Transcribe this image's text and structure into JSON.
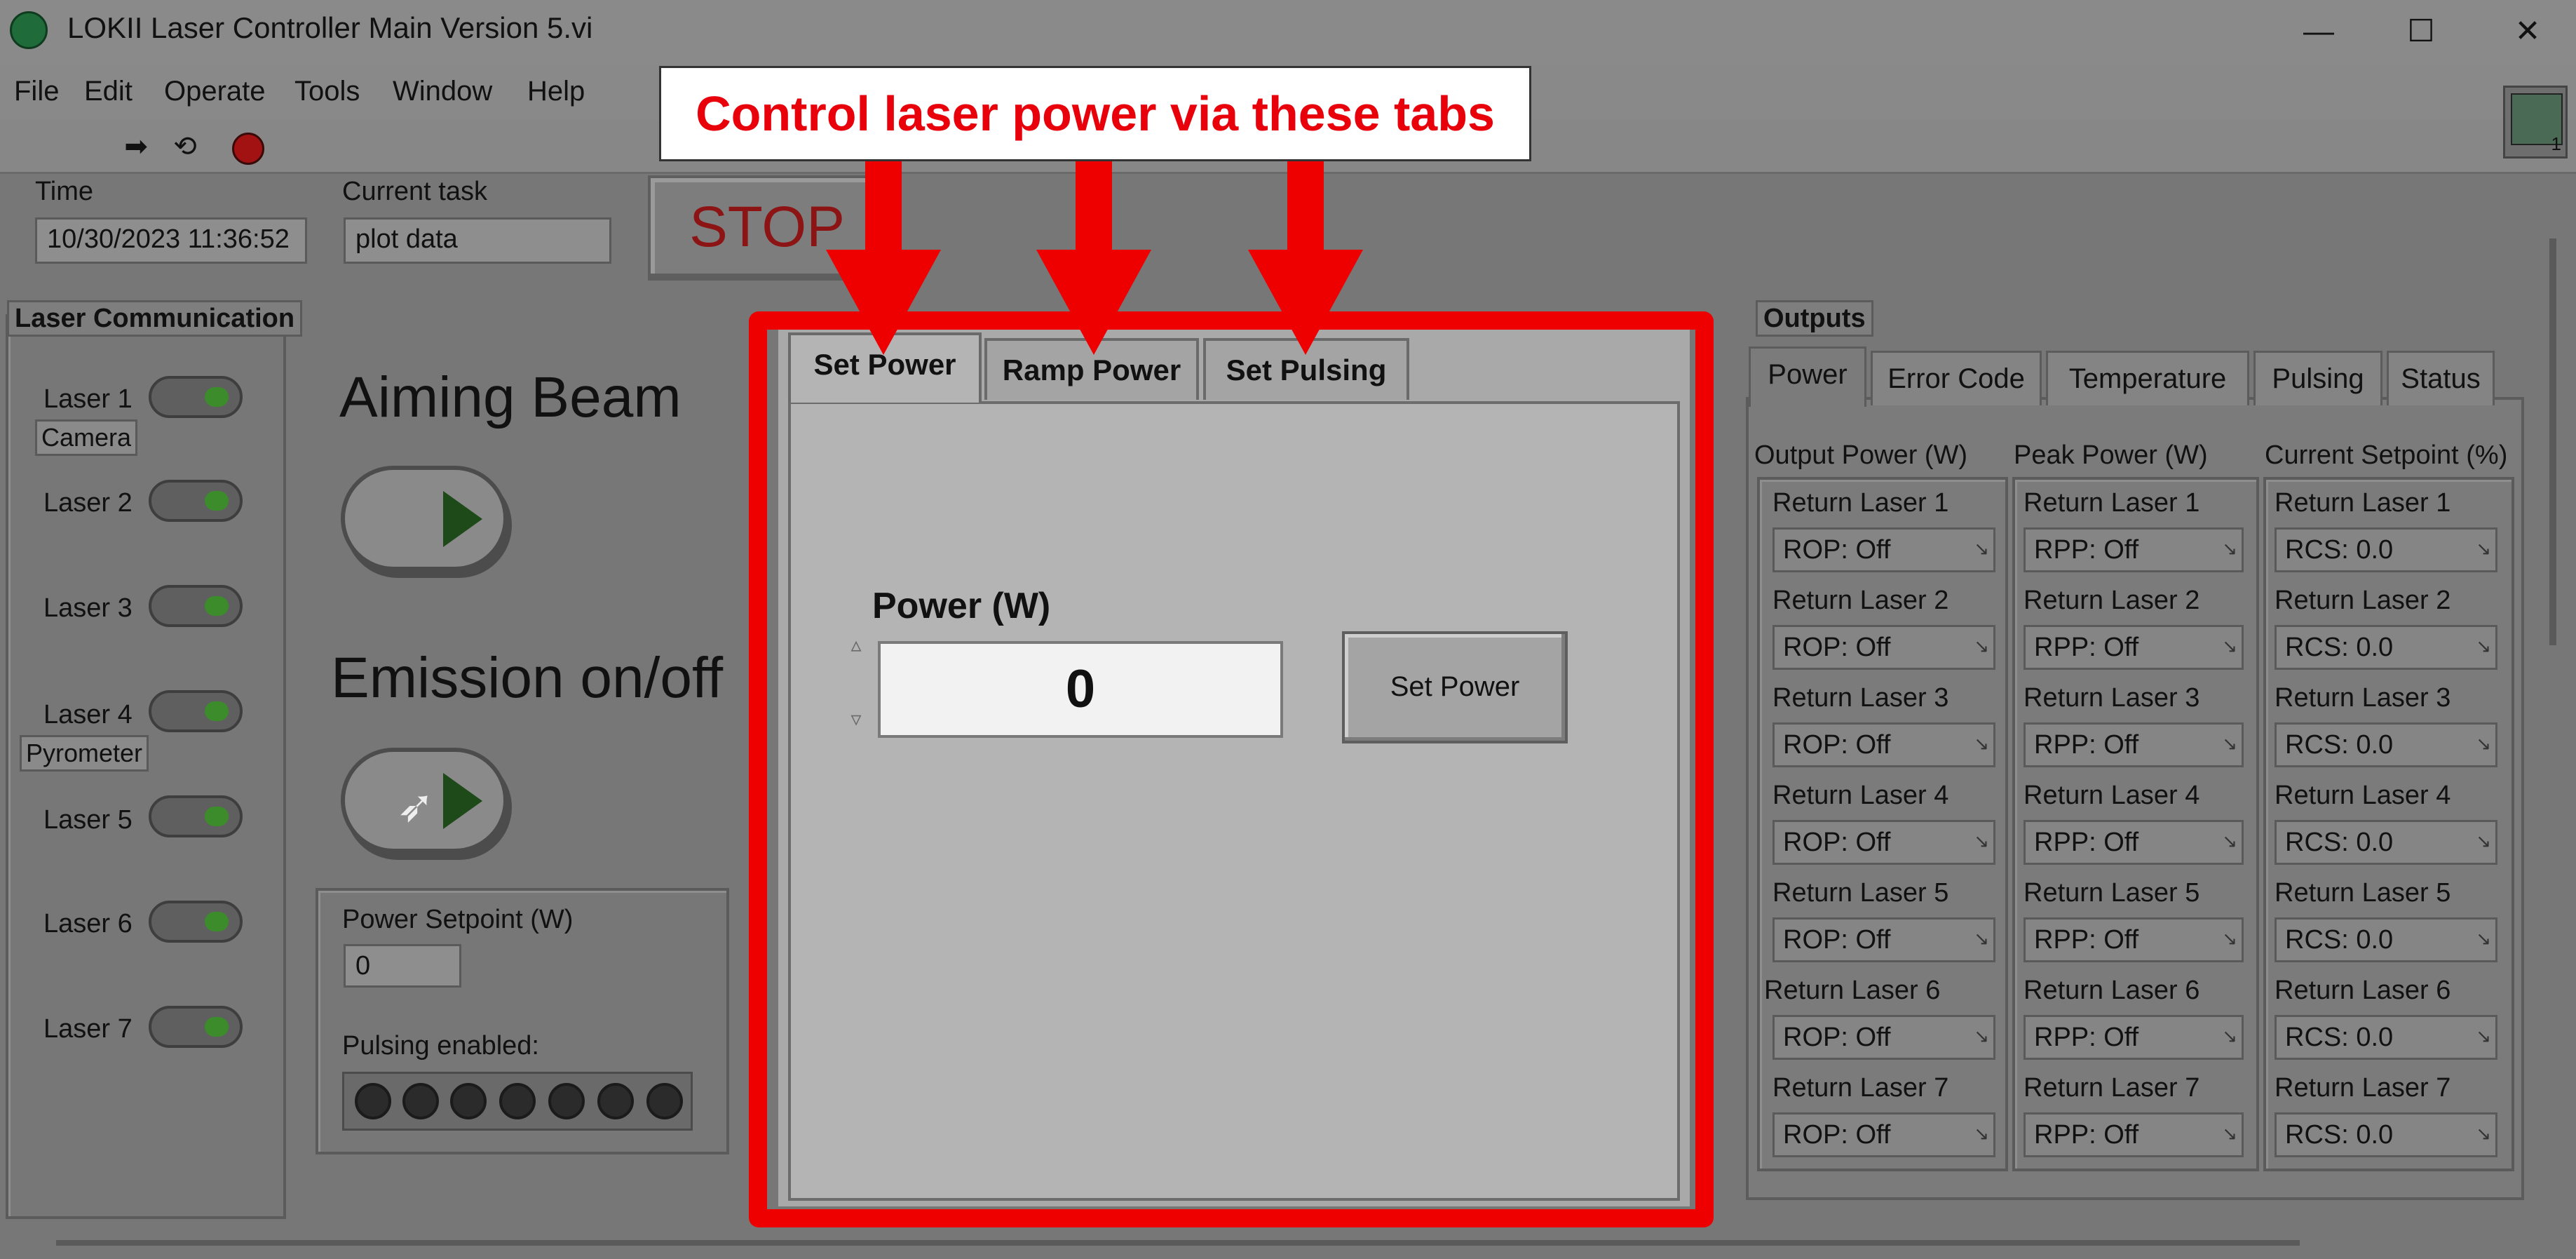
{
  "window": {
    "title": "LOKII Laser Controller Main Version 5.vi",
    "minimize": "—",
    "maximize": "☐",
    "close": "✕"
  },
  "menu": [
    "File",
    "Edit",
    "Operate",
    "Tools",
    "Window",
    "Help"
  ],
  "vi_icon_number": "1",
  "annotation": {
    "text": "Control laser power via these tabs",
    "color": "#ee0000"
  },
  "status": {
    "time_label": "Time",
    "time_value": "10/30/2023 11:36:52",
    "task_label": "Current task",
    "task_value": "plot data",
    "stop_label": "STOP"
  },
  "laser_comm": {
    "title": "Laser Communication",
    "lasers": [
      "Laser 1",
      "Laser 2",
      "Laser 3",
      "Laser 4",
      "Laser 5",
      "Laser 6",
      "Laser 7"
    ],
    "tags": {
      "camera": "Camera",
      "pyrometer": "Pyrometer"
    }
  },
  "aiming_beam_label": "Aiming Beam",
  "emission_label": "Emission on/off",
  "setpoint": {
    "label": "Power Setpoint (W)",
    "value": "0",
    "pulsing_label": "Pulsing enabled:"
  },
  "tabs": {
    "items": [
      "Set Power",
      "Ramp Power",
      "Set Pulsing"
    ],
    "selected": "Set Power",
    "power_label": "Power (W)",
    "power_value": "0",
    "set_button": "Set Power"
  },
  "outputs": {
    "title": "Outputs",
    "tabs": [
      "Power",
      "Error Code",
      "Temperature",
      "Pulsing",
      "Status"
    ],
    "columns": [
      {
        "header": "Output Power (W)",
        "rows": [
          {
            "label": "Return Laser 1",
            "value": "ROP: Off"
          },
          {
            "label": "Return Laser 2",
            "value": "ROP: Off"
          },
          {
            "label": "Return Laser 3",
            "value": "ROP: Off"
          },
          {
            "label": "Return Laser 4",
            "value": "ROP: Off"
          },
          {
            "label": "Return Laser 5",
            "value": "ROP: Off"
          },
          {
            "label": "Return Laser 6",
            "value": "ROP: Off"
          },
          {
            "label": "Return Laser 7",
            "value": "ROP: Off"
          }
        ]
      },
      {
        "header": "Peak Power (W)",
        "rows": [
          {
            "label": "Return Laser 1",
            "value": "RPP: Off"
          },
          {
            "label": "Return Laser 2",
            "value": "RPP: Off"
          },
          {
            "label": "Return Laser 3",
            "value": "RPP: Off"
          },
          {
            "label": "Return Laser 4",
            "value": "RPP: Off"
          },
          {
            "label": "Return Laser 5",
            "value": "RPP: Off"
          },
          {
            "label": "Return Laser 6",
            "value": "RPP: Off"
          },
          {
            "label": "Return Laser 7",
            "value": "RPP: Off"
          }
        ]
      },
      {
        "header": "Current Setpoint (%)",
        "rows": [
          {
            "label": "Return Laser 1",
            "value": "RCS: 0.0"
          },
          {
            "label": "Return Laser 2",
            "value": "RCS: 0.0"
          },
          {
            "label": "Return Laser 3",
            "value": "RCS: 0.0"
          },
          {
            "label": "Return Laser 4",
            "value": "RCS: 0.0"
          },
          {
            "label": "Return Laser 5",
            "value": "RCS: 0.0"
          },
          {
            "label": "Return Laser 6",
            "value": "RCS: 0.0"
          },
          {
            "label": "Return Laser 7",
            "value": "RCS: 0.0"
          }
        ]
      }
    ]
  }
}
